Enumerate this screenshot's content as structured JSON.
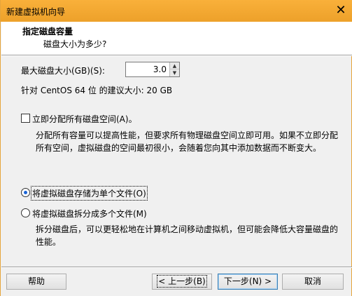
{
  "window": {
    "title": "新建虚拟机向导",
    "close_glyph": "✕"
  },
  "header": {
    "title": "指定磁盘容量",
    "subtitle": "磁盘大小为多少?"
  },
  "disk_size": {
    "label": "最大磁盘大小(GB)(S):",
    "value": "3.0"
  },
  "recommendation": "针对 CentOS 64 位 的建议大小: 20 GB",
  "allocate": {
    "label": "立即分配所有磁盘空间(A)。",
    "checked": false,
    "description": "分配所有容量可以提高性能，但要求所有物理磁盘空间立即可用。如果不立即分配所有空间，虚拟磁盘的空间最初很小，会随着您向其中添加数据而不断变大。"
  },
  "storage_options": [
    {
      "label": "将虚拟磁盘存储为单个文件(O)",
      "selected": true
    },
    {
      "label": "将虚拟磁盘拆分成多个文件(M)",
      "selected": false
    }
  ],
  "split_description": "拆分磁盘后，可以更轻松地在计算机之间移动虚拟机，但可能会降低大容量磁盘的性能。",
  "buttons": {
    "help": "帮助",
    "prev": "< 上一步(B)",
    "next": "下一步(N) >",
    "cancel": "取消"
  },
  "icons": {
    "spin_up": "▲",
    "spin_down": "▼"
  },
  "colors": {
    "titlebar": "#f2a833",
    "accent": "#1a64d6"
  }
}
